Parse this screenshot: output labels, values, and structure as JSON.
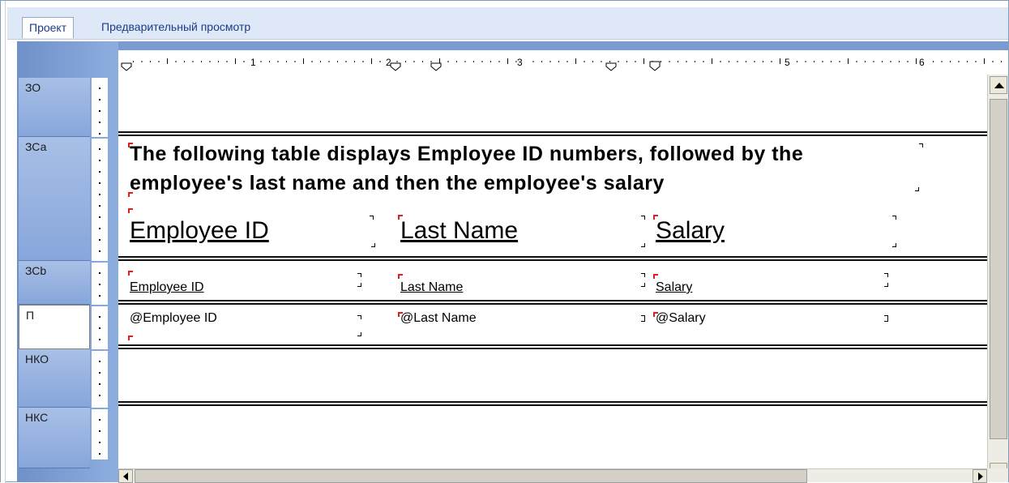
{
  "tabs": [
    {
      "label": "Проект",
      "active": true
    },
    {
      "label": "Предварительный просмотр",
      "active": false
    }
  ],
  "ruler": {
    "numbers": [
      "1",
      "2",
      "3",
      "5",
      "6"
    ]
  },
  "bands": [
    {
      "label": "ЗО",
      "selected": false
    },
    {
      "label": "ЗСа",
      "selected": false
    },
    {
      "label": "ЗСb",
      "selected": false
    },
    {
      "label": "П",
      "selected": true
    },
    {
      "label": "НКО",
      "selected": false
    },
    {
      "label": "НКС",
      "selected": false
    }
  ],
  "report": {
    "intro_line1": "The following table displays Employee ID numbers, followed by the",
    "intro_line2": "employee's last name and then the employee's salary",
    "headers": [
      "Employee ID",
      "Last Name",
      "Salary"
    ],
    "column_labels": [
      "Employee ID",
      "Last Name",
      "Salary"
    ],
    "fields": [
      "@Employee ID",
      "@Last Name",
      "@Salary"
    ]
  },
  "colors": {
    "accent_blue": "#7a9bd2",
    "marker_red": "#e02020"
  }
}
